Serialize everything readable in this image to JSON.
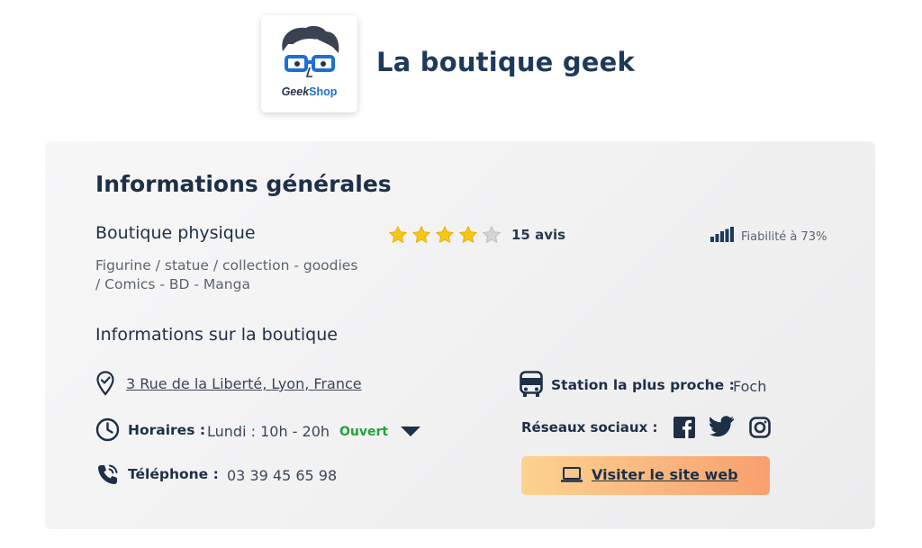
{
  "brand": {
    "logo_word_1": "Geek",
    "logo_word_2": "Shop",
    "shop_name": "La boutique geek"
  },
  "general": {
    "heading": "Informations générales",
    "shop_type": "Boutique physique",
    "categories": "Figurine / statue / collection - goodies / Comics - BD - Manga",
    "rating": {
      "stars_filled": 4,
      "stars_total": 5,
      "reviews_label": "15 avis"
    },
    "reliability": {
      "label": "Fiabilité à 73%",
      "percent": 73,
      "icon": "signal-bars-icon"
    }
  },
  "shop_info": {
    "heading": "Informations sur la boutique",
    "address": "3 Rue de la Liberté, Lyon, France",
    "hours_label": "Horaires :",
    "hours_value": "Lundi : 10h - 20h",
    "open_status": "Ouvert",
    "phone_label": "Téléphone :",
    "phone_value": "03 39 45 65 98",
    "station_label": "Station la plus proche :",
    "station_value": "Foch",
    "social_label": "Réseaux sociaux :",
    "social_icons": [
      "facebook-icon",
      "twitter-icon",
      "instagram-icon"
    ],
    "website_button": "Visiter le site web"
  },
  "colors": {
    "primary_text": "#1e3046",
    "open_green": "#21a337",
    "star_gold": "#f5c518",
    "star_gray": "#c8c8c8",
    "button_gradient_start": "#fcd290",
    "button_gradient_end": "#f7a070"
  }
}
